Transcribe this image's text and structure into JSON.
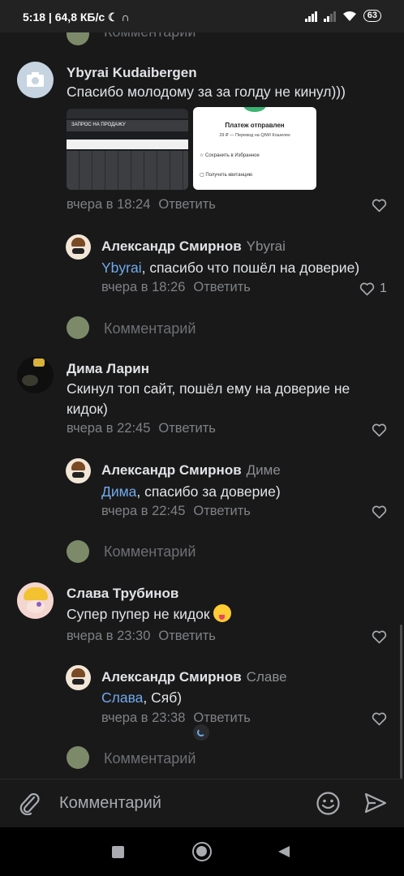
{
  "status": {
    "time": "5:18",
    "network": "64,8 КБ/с",
    "battery": "63"
  },
  "comments": [
    {
      "author": "Ybyrai Kudaibergen",
      "text": "Спасибо молодому за за голду не кинул)))",
      "date": "вчера в 18:24",
      "reply_label": "Ответить",
      "attachments": {
        "left_title": "ЗАПРОС НА ПРОДАЖУ",
        "right_title": "Платеж отправлен",
        "right_sub": "29 ₽ — Перевод на QIWI Кошелек",
        "right_item1": "Сохранить в Избранное",
        "right_item2": "Получить квитанцию"
      },
      "reply": {
        "author": "Александр Смирнов",
        "addressee": "Ybyrai",
        "mention": "Ybyrai",
        "text": ", спасибо что пошёл на доверие)",
        "date": "вчера в 18:26",
        "reply_label": "Ответить",
        "likes": "1"
      }
    },
    {
      "author": "Дима Ларин",
      "text": "Скинул топ сайт, пошёл ему на доверие не кидок)",
      "date": "вчера в 22:45",
      "reply_label": "Ответить",
      "reply": {
        "author": "Александр Смирнов",
        "addressee": "Диме",
        "mention": "Дима",
        "text": ", спасибо за доверие)",
        "date": "вчера в 22:45",
        "reply_label": "Ответить"
      }
    },
    {
      "author": "Слава Трубинов",
      "text": "Супер пупер не кидок",
      "date": "вчера в 23:30",
      "reply_label": "Ответить",
      "reply": {
        "author": "Александр Смирнов",
        "addressee": "Славе",
        "mention": "Слава",
        "text": ", Сяб)",
        "date": "вчера в 23:38",
        "reply_label": "Ответить"
      }
    }
  ],
  "comment_placeholder": "Комментарий",
  "input": {
    "placeholder": "Комментарий"
  },
  "colors": {
    "background": "#19191a",
    "mention": "#71aaeb",
    "meta": "#7f8185"
  }
}
